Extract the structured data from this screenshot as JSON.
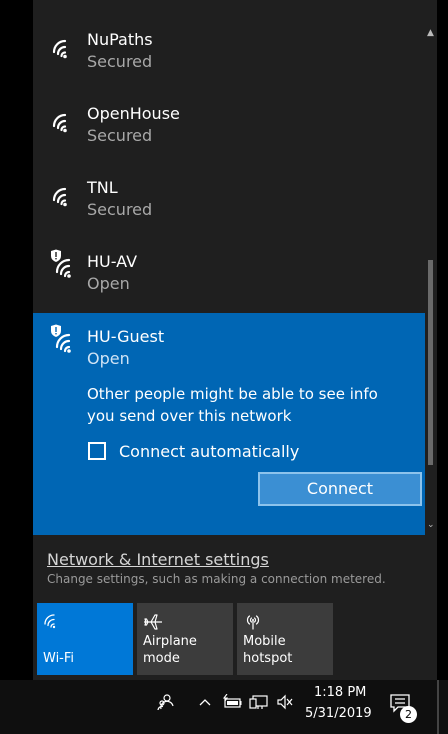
{
  "networks": [
    {
      "name": "NuPaths",
      "status": "Secured",
      "icon": "wifi-icon"
    },
    {
      "name": "OpenHouse",
      "status": "Secured",
      "icon": "wifi-icon"
    },
    {
      "name": "TNL",
      "status": "Secured",
      "icon": "wifi-icon"
    },
    {
      "name": "HU-AV",
      "status": "Open",
      "icon": "wifi-shield-icon"
    }
  ],
  "selected": {
    "name": "HU-Guest",
    "status": "Open",
    "icon": "wifi-shield-icon",
    "warning": "Other people might be able to see info you send over this network",
    "connect_auto_label": "Connect automatically",
    "connect_auto_checked": false,
    "connect_label": "Connect"
  },
  "settings": {
    "link": "Network & Internet settings",
    "description": "Change settings, such as making a connection metered."
  },
  "quick_actions": [
    {
      "label": "Wi-Fi",
      "icon": "wifi-icon",
      "active": true
    },
    {
      "label": "Airplane mode",
      "icon": "airplane-icon",
      "active": false
    },
    {
      "label": "Mobile hotspot",
      "icon": "hotspot-icon",
      "active": false
    }
  ],
  "taskbar": {
    "time": "1:18 PM",
    "date": "5/31/2019",
    "notification_count": "2"
  },
  "colors": {
    "accent": "#0078d7",
    "selected_bg": "#0066b4",
    "panel_bg": "#1f1f1f"
  }
}
